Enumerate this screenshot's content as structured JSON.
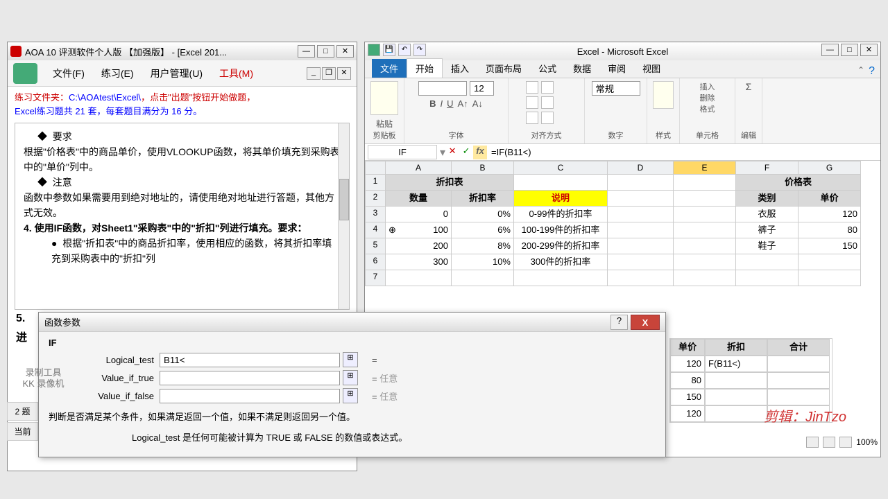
{
  "aoa": {
    "title": "AOA 10 评测软件个人版   【加强版】 - [Excel 201...",
    "menu": {
      "file": "文件(F)",
      "practice": "练习(E)",
      "user": "用户管理(U)",
      "tools": "工具(M)"
    },
    "info_line1_a": "练习文件夹：",
    "info_line1_b": "C:\\AOAtest\\Excel\\",
    "info_line1_c": "，点击\"出题\"按钮开始做题，",
    "info_line2_a": "Excel练习题共 ",
    "info_line2_b": "21",
    "info_line2_c": " 套，每套题目满分为 ",
    "info_line2_d": "16",
    "info_line2_e": " 分。",
    "body": {
      "req": "要求",
      "p1": "根据\"价格表\"中的商品单价，使用VLOOKUP函数，将其单价填充到采购表中的\"单价\"列中。",
      "note": "注意",
      "p2": "函数中参数如果需要用到绝对地址的，请使用绝对地址进行答题，其他方式无效。",
      "p3": "4.    使用IF函数，对Sheet1\"采购表\"中的\"折扣\"列进行填充。要求：",
      "p4": "根据\"折扣表\"中的商品折扣率，使用相应的函数，将其折扣率填充到采购表中的\"折扣\"列",
      "p5": "5.",
      "p6": "进"
    },
    "left_tabs": {
      "t1": "2 题",
      "t2": "当前"
    }
  },
  "excel": {
    "title": "Excel - Microsoft Excel",
    "tabs": {
      "file": "文件",
      "home": "开始",
      "insert": "插入",
      "layout": "页面布局",
      "formula": "公式",
      "data": "数据",
      "review": "审阅",
      "view": "视图"
    },
    "groups": {
      "clipboard": "剪贴板",
      "paste": "粘贴",
      "font": "字体",
      "align": "对齐方式",
      "number": "数字",
      "styles": "样式",
      "cells": "单元格",
      "editing": "编辑"
    },
    "font_size": "12",
    "num_fmt": "常规",
    "cell_ops": {
      "insert": "插入",
      "delete": "删除",
      "format": "格式"
    },
    "namebox": "IF",
    "formula": "=IF(B11<)",
    "cols": [
      "A",
      "B",
      "C",
      "D",
      "E",
      "F",
      "G"
    ],
    "rows": [
      "1",
      "2",
      "3",
      "4",
      "5",
      "6",
      "7"
    ],
    "grid": {
      "A1": "折扣表",
      "F1": "价格表",
      "A2": "数量",
      "B2": "折扣率",
      "C2": "说明",
      "F2": "类别",
      "G2": "单价",
      "A3": "0",
      "B3": "0%",
      "C3": "0-99件的折扣率",
      "F3": "衣服",
      "G3": "120",
      "A4": "100",
      "B4": "6%",
      "C4": "100-199件的折扣率",
      "F4": "裤子",
      "G4": "80",
      "A5": "200",
      "B5": "8%",
      "C5": "200-299件的折扣率",
      "F5": "鞋子",
      "G5": "150",
      "A6": "300",
      "B6": "10%",
      "C6": "300件的折扣率"
    },
    "lower": {
      "h1": "单价",
      "h2": "折扣",
      "h3": "合计",
      "r1_1": "120",
      "r1_2": "F(B11<)",
      "r2_1": "80",
      "r3_1": "150",
      "r4_1": "120"
    },
    "zoom": "100%"
  },
  "dialog": {
    "title": "函数参数",
    "fn": "IF",
    "labels": {
      "lt": "Logical_test",
      "vt": "Value_if_true",
      "vf": "Value_if_false"
    },
    "values": {
      "lt": "B11<",
      "vt": "",
      "vf": ""
    },
    "eq": "=",
    "any": "任意",
    "desc1": "判断是否满足某个条件，如果满足返回一个值，如果不满足则返回另一个值。",
    "desc2": "Logical_test    是任何可能被计算为 TRUE 或 FALSE 的数值或表达式。"
  },
  "watermark": {
    "kk1": "录制工具",
    "kk2": "KK 录像机",
    "jt": "剪辑：JinTzo"
  },
  "chart_data": {
    "type": "table",
    "tables": [
      {
        "title": "折扣表",
        "columns": [
          "数量",
          "折扣率",
          "说明"
        ],
        "rows": [
          [
            0,
            "0%",
            "0-99件的折扣率"
          ],
          [
            100,
            "6%",
            "100-199件的折扣率"
          ],
          [
            200,
            "8%",
            "200-299件的折扣率"
          ],
          [
            300,
            "10%",
            "300件的折扣率"
          ]
        ]
      },
      {
        "title": "价格表",
        "columns": [
          "类别",
          "单价"
        ],
        "rows": [
          [
            "衣服",
            120
          ],
          [
            "裤子",
            80
          ],
          [
            "鞋子",
            150
          ]
        ]
      }
    ]
  }
}
